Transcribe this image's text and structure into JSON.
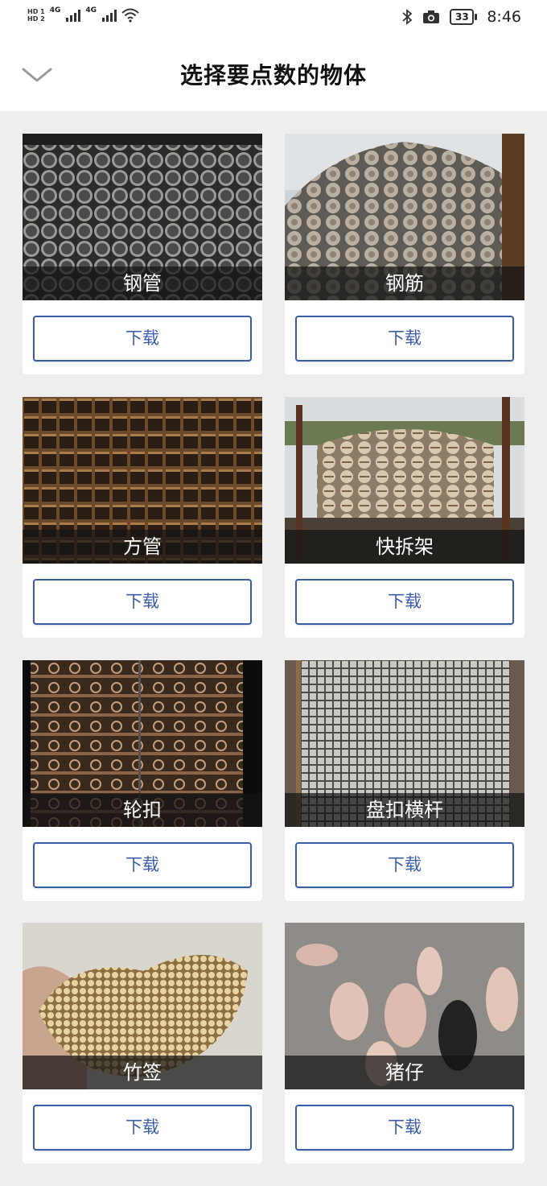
{
  "status_bar": {
    "sim1": "HD 1",
    "sim2": "HD 2",
    "network1": "4G",
    "network2": "4G",
    "battery": "33",
    "time": "8:46",
    "icons": [
      "signal-icon",
      "wifi-icon",
      "bluetooth-icon",
      "camera-icon",
      "battery-icon"
    ]
  },
  "header": {
    "title": "选择要点数的物体",
    "back_icon": "chevron-down-icon"
  },
  "colors": {
    "accent": "#3a5da8",
    "background": "#eeeeee",
    "caption_overlay": "#141414"
  },
  "items": [
    {
      "label": "钢管",
      "button": "下载"
    },
    {
      "label": "钢筋",
      "button": "下载"
    },
    {
      "label": "方管",
      "button": "下载"
    },
    {
      "label": "快拆架",
      "button": "下载"
    },
    {
      "label": "轮扣",
      "button": "下载"
    },
    {
      "label": "盘扣横杆",
      "button": "下载"
    },
    {
      "label": "竹签",
      "button": "下载"
    },
    {
      "label": "猪仔",
      "button": "下载"
    }
  ]
}
